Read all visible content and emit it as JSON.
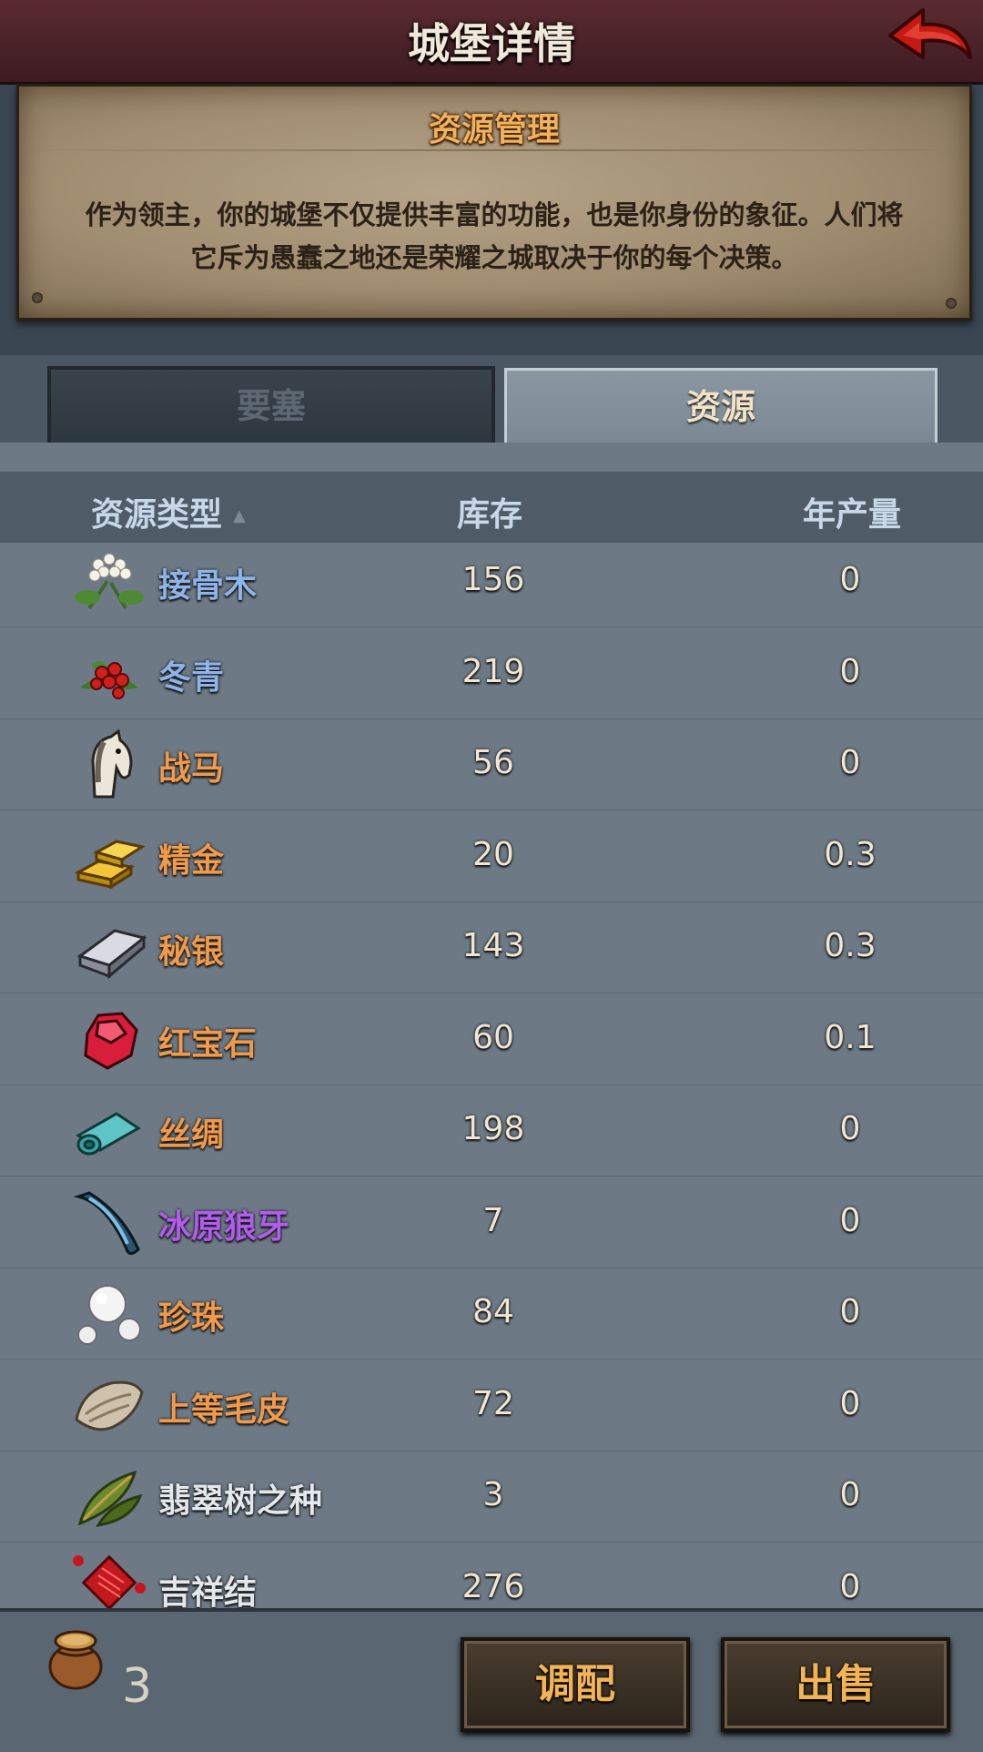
{
  "header": {
    "title": "城堡详情",
    "back_icon": "back-arrow-icon"
  },
  "info": {
    "title": "资源管理",
    "line1": "作为领主，你的城堡不仅提供丰富的功能，也是你身份的象征。人们将",
    "line2": "它斥为愚蠢之地还是荣耀之城取决于你的每个决策。"
  },
  "tabs": [
    {
      "label": "要塞",
      "active": false
    },
    {
      "label": "资源",
      "active": true
    }
  ],
  "columns": {
    "type": "资源类型",
    "stock": "库存",
    "annual": "年产量"
  },
  "rows": [
    {
      "name": "接骨木",
      "stock": "156",
      "annual": "0",
      "color": "#8fb4e8",
      "icon": "elderflower-icon"
    },
    {
      "name": "冬青",
      "stock": "219",
      "annual": "0",
      "color": "#8fb4e8",
      "icon": "holly-berries-icon"
    },
    {
      "name": "战马",
      "stock": "56",
      "annual": "0",
      "color": "#f09a4a",
      "icon": "warhorse-icon"
    },
    {
      "name": "精金",
      "stock": "20",
      "annual": "0.3",
      "color": "#f09a4a",
      "icon": "gold-bars-icon"
    },
    {
      "name": "秘银",
      "stock": "143",
      "annual": "0.3",
      "color": "#f09a4a",
      "icon": "mithril-ingot-icon"
    },
    {
      "name": "红宝石",
      "stock": "60",
      "annual": "0.1",
      "color": "#f09a4a",
      "icon": "ruby-icon"
    },
    {
      "name": "丝绸",
      "stock": "198",
      "annual": "0",
      "color": "#f09a4a",
      "icon": "silk-roll-icon"
    },
    {
      "name": "冰原狼牙",
      "stock": "7",
      "annual": "0",
      "color": "#b35cf0",
      "icon": "wolf-fang-icon"
    },
    {
      "name": "珍珠",
      "stock": "84",
      "annual": "0",
      "color": "#f09a4a",
      "icon": "pearls-icon"
    },
    {
      "name": "上等毛皮",
      "stock": "72",
      "annual": "0",
      "color": "#f09a4a",
      "icon": "fur-pelt-icon"
    },
    {
      "name": "翡翠树之种",
      "stock": "3",
      "annual": "0",
      "color": "#e4e8ec",
      "icon": "emerald-seed-leaf-icon"
    },
    {
      "name": "吉祥结",
      "stock": "276",
      "annual": "0",
      "color": "#e4e8ec",
      "icon": "chinese-knot-icon"
    }
  ],
  "footer": {
    "sack_count": "3",
    "sack_icon": "grain-sack-icon",
    "allocate_label": "调配",
    "sell_label": "出售"
  }
}
